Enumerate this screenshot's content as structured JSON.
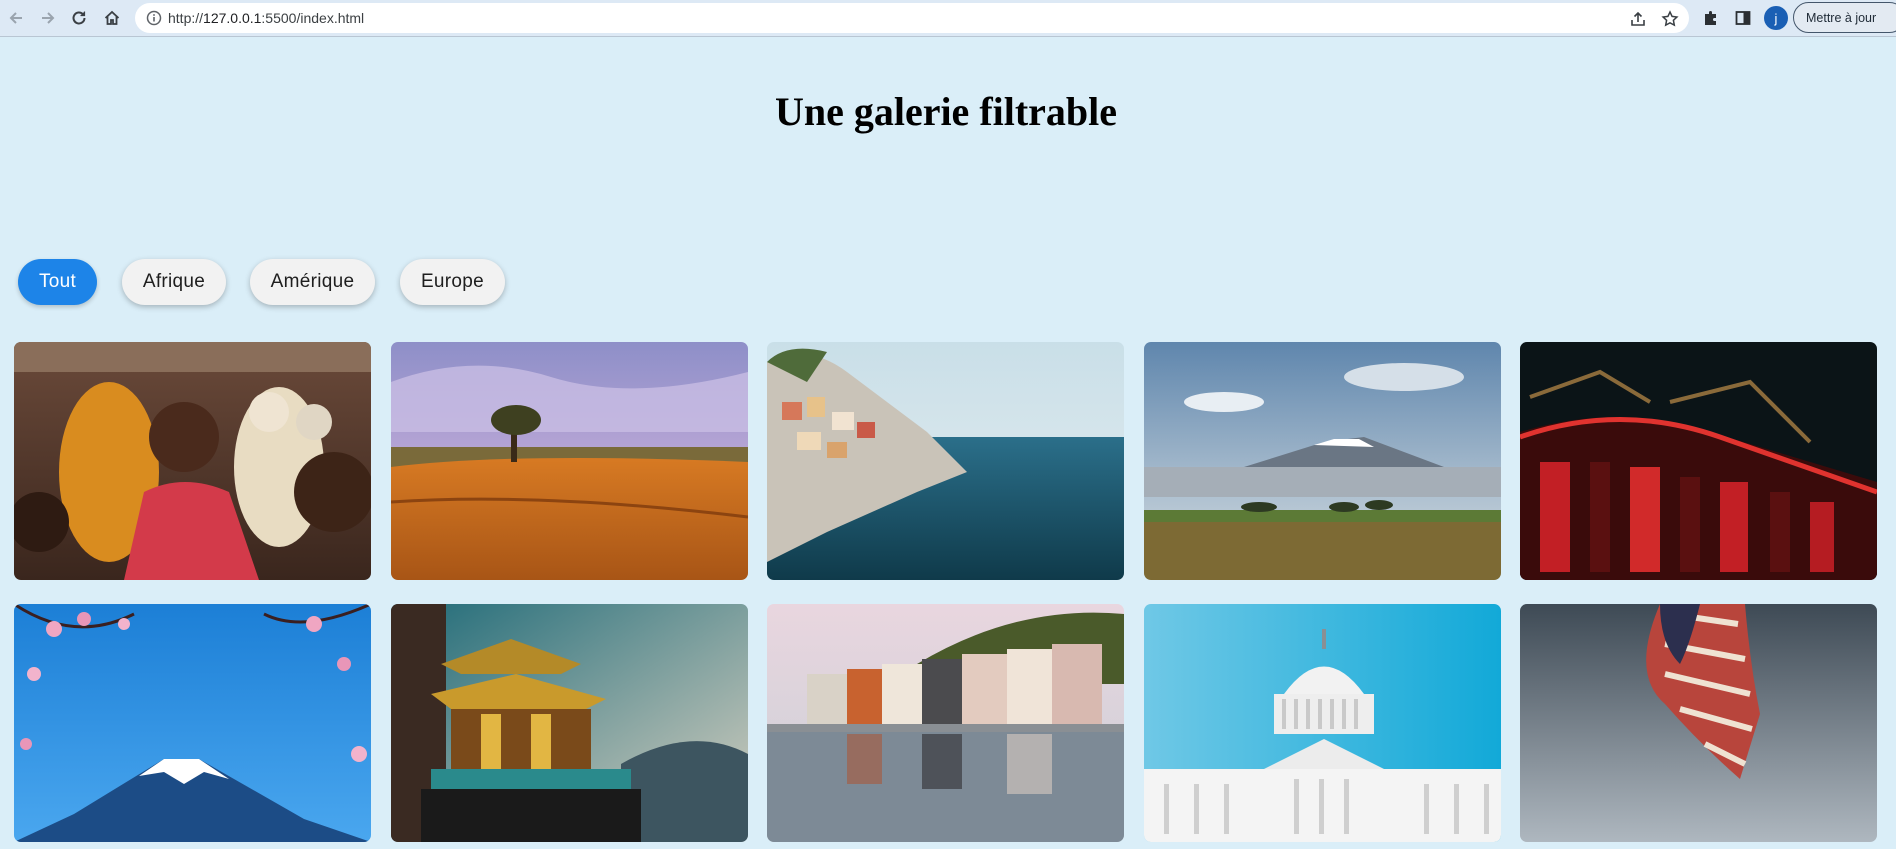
{
  "browser": {
    "url_prefix": "http://",
    "url_host": "127.0.0.1",
    "url_rest": ":5500/index.html",
    "profile_initial": "j",
    "update_label": "Mettre à jour"
  },
  "page": {
    "title": "Une galerie filtrable"
  },
  "filters": [
    {
      "label": "Tout",
      "active": true
    },
    {
      "label": "Afrique",
      "active": false
    },
    {
      "label": "Amérique",
      "active": false
    },
    {
      "label": "Europe",
      "active": false
    }
  ],
  "colors": {
    "background": "#daeef8",
    "active_filter": "#1d84e8",
    "inactive_filter": "#f2f2f2"
  },
  "gallery": {
    "images": [
      {
        "subject": "african-children-crowd"
      },
      {
        "subject": "desert-dunes-tree"
      },
      {
        "subject": "cinque-terre-coastal-village"
      },
      {
        "subject": "kilimanjaro-savanna"
      },
      {
        "subject": "red-asian-temple-night"
      },
      {
        "subject": "mount-fuji-cherry-blossoms"
      },
      {
        "subject": "golden-tibetan-temple"
      },
      {
        "subject": "riverside-town-reflection"
      },
      {
        "subject": "us-capitol-building"
      },
      {
        "subject": "american-flag-sky"
      }
    ]
  }
}
